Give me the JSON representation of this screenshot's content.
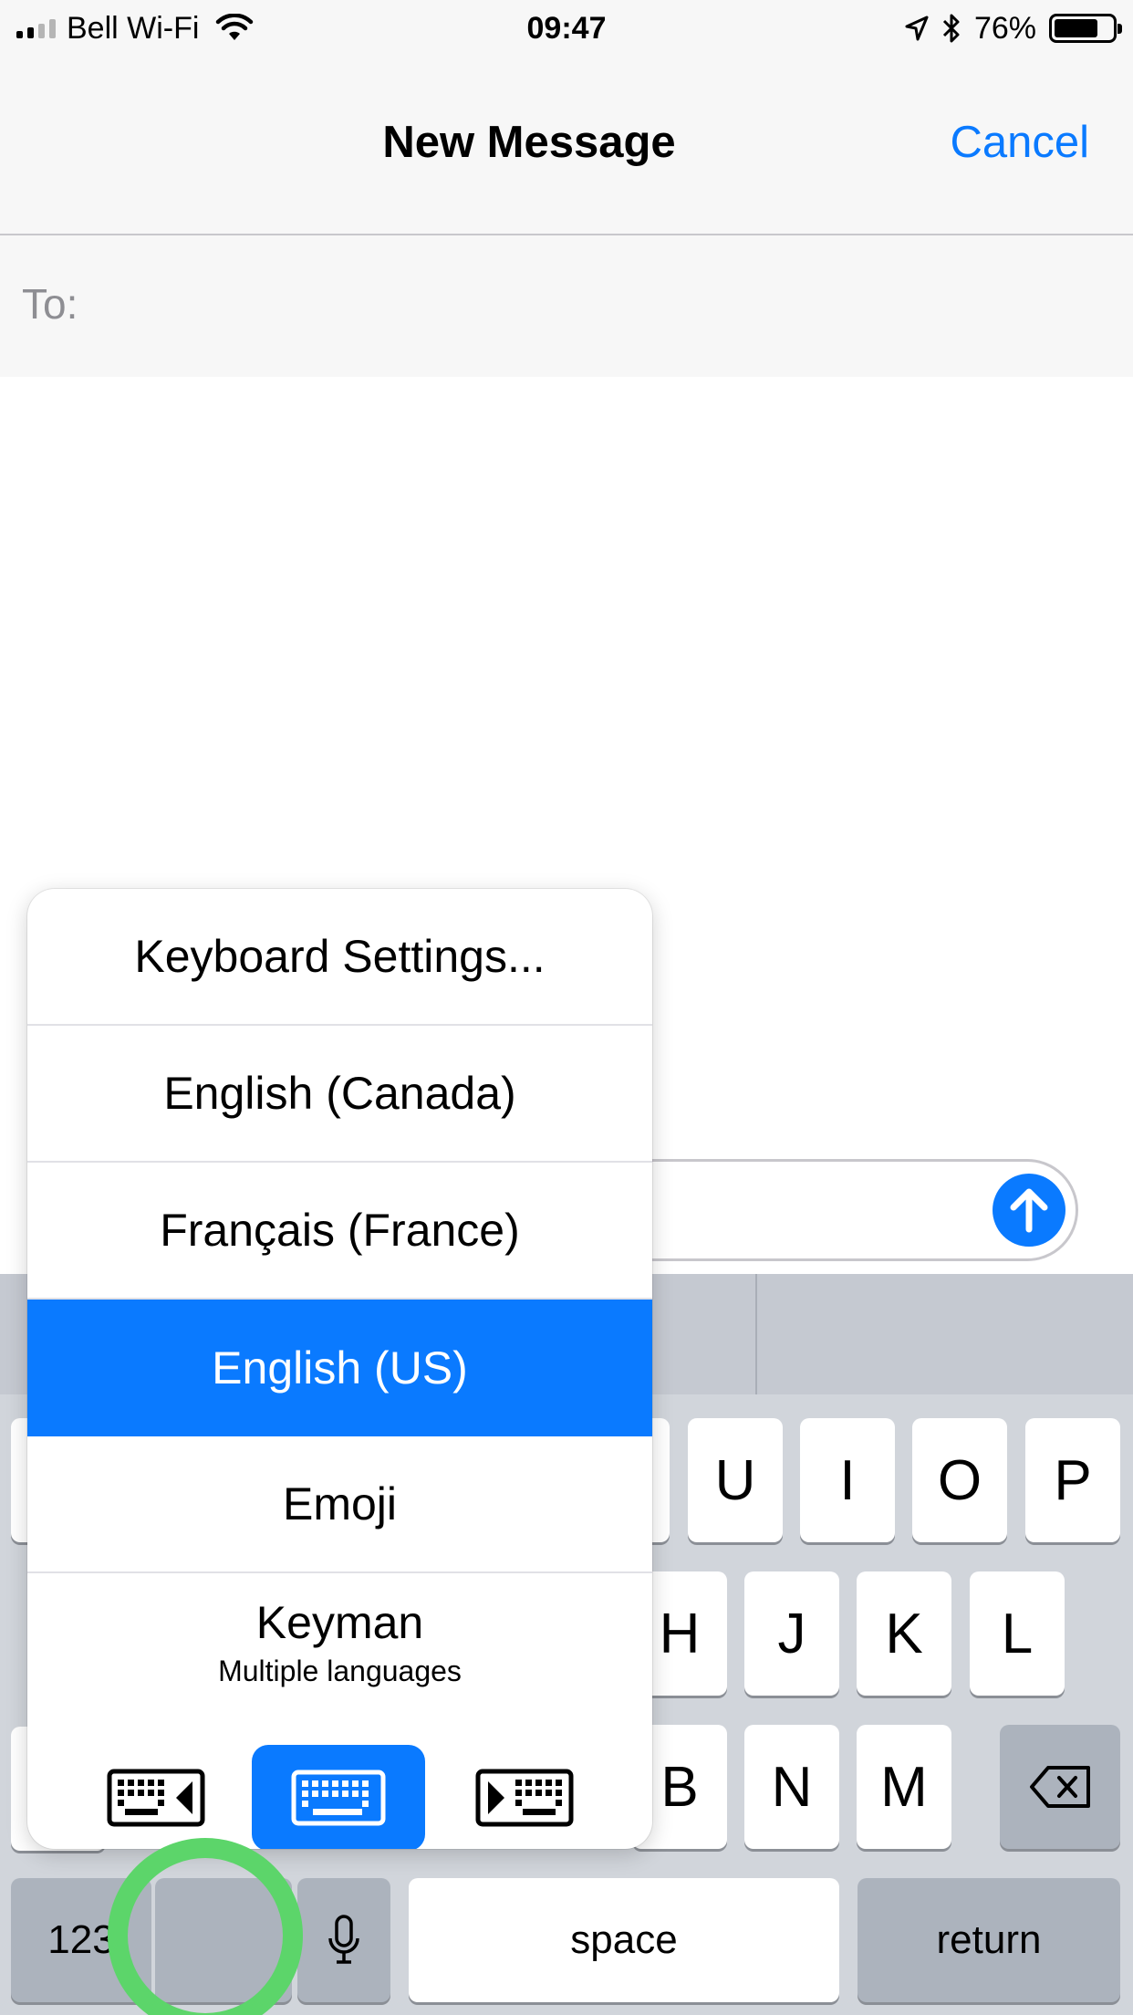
{
  "status_bar": {
    "carrier": "Bell Wi-Fi",
    "time": "09:47",
    "battery_percent": "76%",
    "battery_level": 0.76,
    "icons": [
      "signal-bars-icon",
      "wifi-icon",
      "location-arrow-icon",
      "bluetooth-icon",
      "battery-icon"
    ]
  },
  "nav": {
    "title": "New Message",
    "cancel_label": "Cancel"
  },
  "compose": {
    "to_label": "To:"
  },
  "keyboard_menu": {
    "items": [
      {
        "label": "Keyboard Settings..."
      },
      {
        "label": "English (Canada)"
      },
      {
        "label": "Français (France)"
      },
      {
        "label": "English (US)",
        "selected": true
      },
      {
        "label": "Emoji"
      },
      {
        "label": "Keyman",
        "sublabel": "Multiple languages"
      }
    ],
    "modes": [
      "keyboard-left-icon",
      "keyboard-full-icon",
      "keyboard-right-icon"
    ],
    "active_mode": "keyboard-full-icon"
  },
  "keyboard": {
    "row1": [
      "U",
      "I",
      "O",
      "P"
    ],
    "row2": [
      "H",
      "J",
      "K",
      "L"
    ],
    "row3": [
      "B",
      "N",
      "M"
    ],
    "numbers_label": "123",
    "space_label": "space",
    "return_label": "return"
  },
  "colors": {
    "accent": "#0a7aff",
    "highlight_ring": "#5cd56a",
    "keyboard_bg": "#d1d5db"
  }
}
